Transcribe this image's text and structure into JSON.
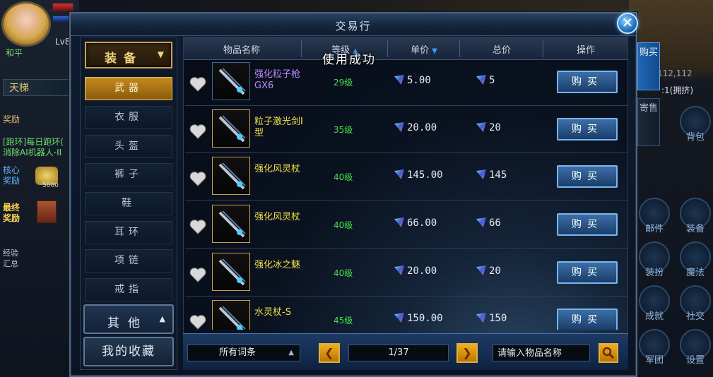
{
  "hud": {
    "level": "Lv8",
    "peace_mode": "和平",
    "ladder": "天梯",
    "tasks": {
      "reward": "奖励",
      "daily": "[跑环]每日跑环(",
      "daily_sub": "消除AI机器人-II",
      "core_reward": "核心\n奖励",
      "gold_count": "5000",
      "final_reward": "最终\n奖励",
      "exp_summary": "经验\n汇总"
    },
    "coords": "112,112",
    "mode": ":1(拥挤)",
    "right_buttons": [
      "背包",
      "装备",
      "邮件",
      "魔法",
      "装扮",
      "社交",
      "成就",
      "设置",
      "军团"
    ]
  },
  "dialog": {
    "title": "交易行",
    "close": "✕",
    "side_tabs": [
      "购买",
      "寄售"
    ],
    "toast": "使用成功",
    "categories": {
      "header": "装备",
      "items": [
        "武器",
        "衣服",
        "头盔",
        "裤子",
        "鞋",
        "耳环",
        "项链",
        "戒指"
      ],
      "active_index": 0,
      "other": "其他",
      "favorites": "我的收藏"
    },
    "columns": [
      "物品名称",
      "等级",
      "单价",
      "总价",
      "操作"
    ],
    "rows": [
      {
        "name": "强化粒子枪GX6",
        "level": "29级",
        "price": "5.00",
        "total": "5",
        "action": "购买",
        "quality": "purple"
      },
      {
        "name": "粒子激光剑I型",
        "level": "35级",
        "price": "20.00",
        "total": "20",
        "action": "购买",
        "quality": "yellow"
      },
      {
        "name": "强化风灵杖",
        "level": "40级",
        "price": "145.00",
        "total": "145",
        "action": "购买",
        "quality": "yellow"
      },
      {
        "name": "强化风灵杖",
        "level": "40级",
        "price": "66.00",
        "total": "66",
        "action": "购买",
        "quality": "yellow"
      },
      {
        "name": "强化冰之魅",
        "level": "40级",
        "price": "20.00",
        "total": "20",
        "action": "购买",
        "quality": "yellow"
      },
      {
        "name": "水灵杖-S",
        "level": "45级",
        "price": "150.00",
        "total": "150",
        "action": "购买",
        "quality": "yellow"
      }
    ],
    "footer": {
      "filter": "所有词条",
      "pagination": "1/37",
      "search_placeholder": "请输入物品名称"
    }
  },
  "colors": {
    "accent_gold": "#c8a15a",
    "level_green": "#46e046",
    "name_yellow": "#f2e24a",
    "name_purple": "#b98cff",
    "buy_blue": "#3c6fa6"
  }
}
